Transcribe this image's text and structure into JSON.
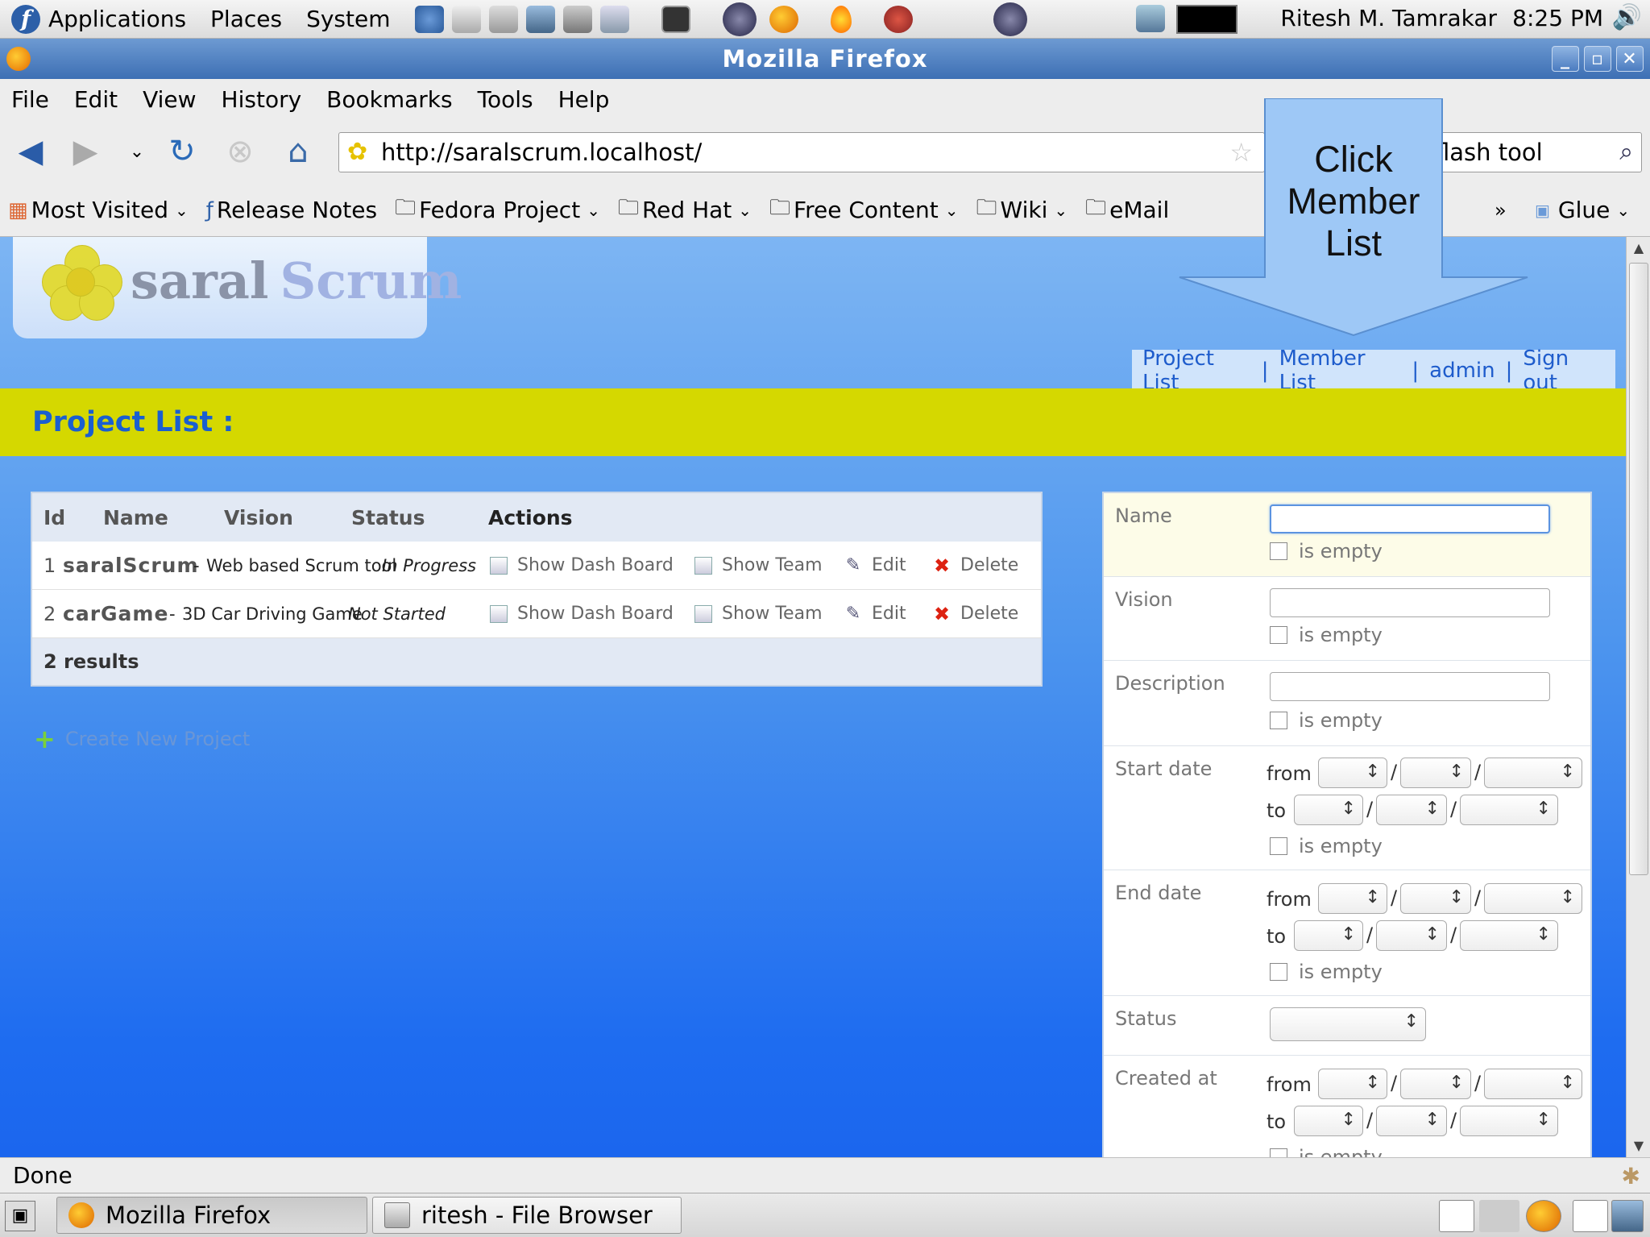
{
  "panel": {
    "menus": [
      "Applications",
      "Places",
      "System"
    ],
    "user": "Ritesh M. Tamrakar",
    "clock": "8:25 PM"
  },
  "window": {
    "title": "Mozilla Firefox"
  },
  "menubar": [
    "File",
    "Edit",
    "View",
    "History",
    "Bookmarks",
    "Tools",
    "Help"
  ],
  "navbar": {
    "url": "http://saralscrum.localhost/",
    "search_value": "flash tool"
  },
  "bookmarks": {
    "items": [
      "Most Visited",
      "Release Notes",
      "Fedora Project",
      "Red Hat",
      "Free Content",
      "Wiki",
      "eMail"
    ],
    "more": "»",
    "glue": "Glue"
  },
  "site": {
    "logo_saral": "saral",
    "logo_scrum": "Scrum",
    "user_links": [
      "Project List",
      "Member List",
      "admin",
      "Sign out"
    ],
    "page_title": "Project List :"
  },
  "project_table": {
    "headers": [
      "Id",
      "Name",
      "Vision",
      "Status",
      "Actions"
    ],
    "rows": [
      {
        "id": "1",
        "name": "saralScrum",
        "sep": "-",
        "vision": "Web based Scrum tool",
        "status": "In Progress"
      },
      {
        "id": "2",
        "name": "carGame",
        "sep": "-",
        "vision": "3D Car Driving Game",
        "status": "Not Started"
      }
    ],
    "actions": [
      "Show Dash Board",
      "Show Team",
      "Edit",
      "Delete"
    ],
    "results": "2 results"
  },
  "create_link": "Create New Project",
  "filters": {
    "name": "Name",
    "vision": "Vision",
    "description": "Description",
    "start_date": "Start date",
    "end_date": "End date",
    "status": "Status",
    "created_at": "Created at",
    "from": "from",
    "to": "to",
    "is_empty": "is empty",
    "slash": "/"
  },
  "callout": {
    "line1": "Click",
    "line2": "Member",
    "line3": "List"
  },
  "statusbar": {
    "text": "Done"
  },
  "taskbar": {
    "tasks": [
      "Mozilla Firefox",
      "ritesh - File Browser"
    ]
  },
  "colors": {
    "title_band": "#d5d800",
    "link": "#1856c9",
    "page_bg": "#1e6cf0"
  }
}
